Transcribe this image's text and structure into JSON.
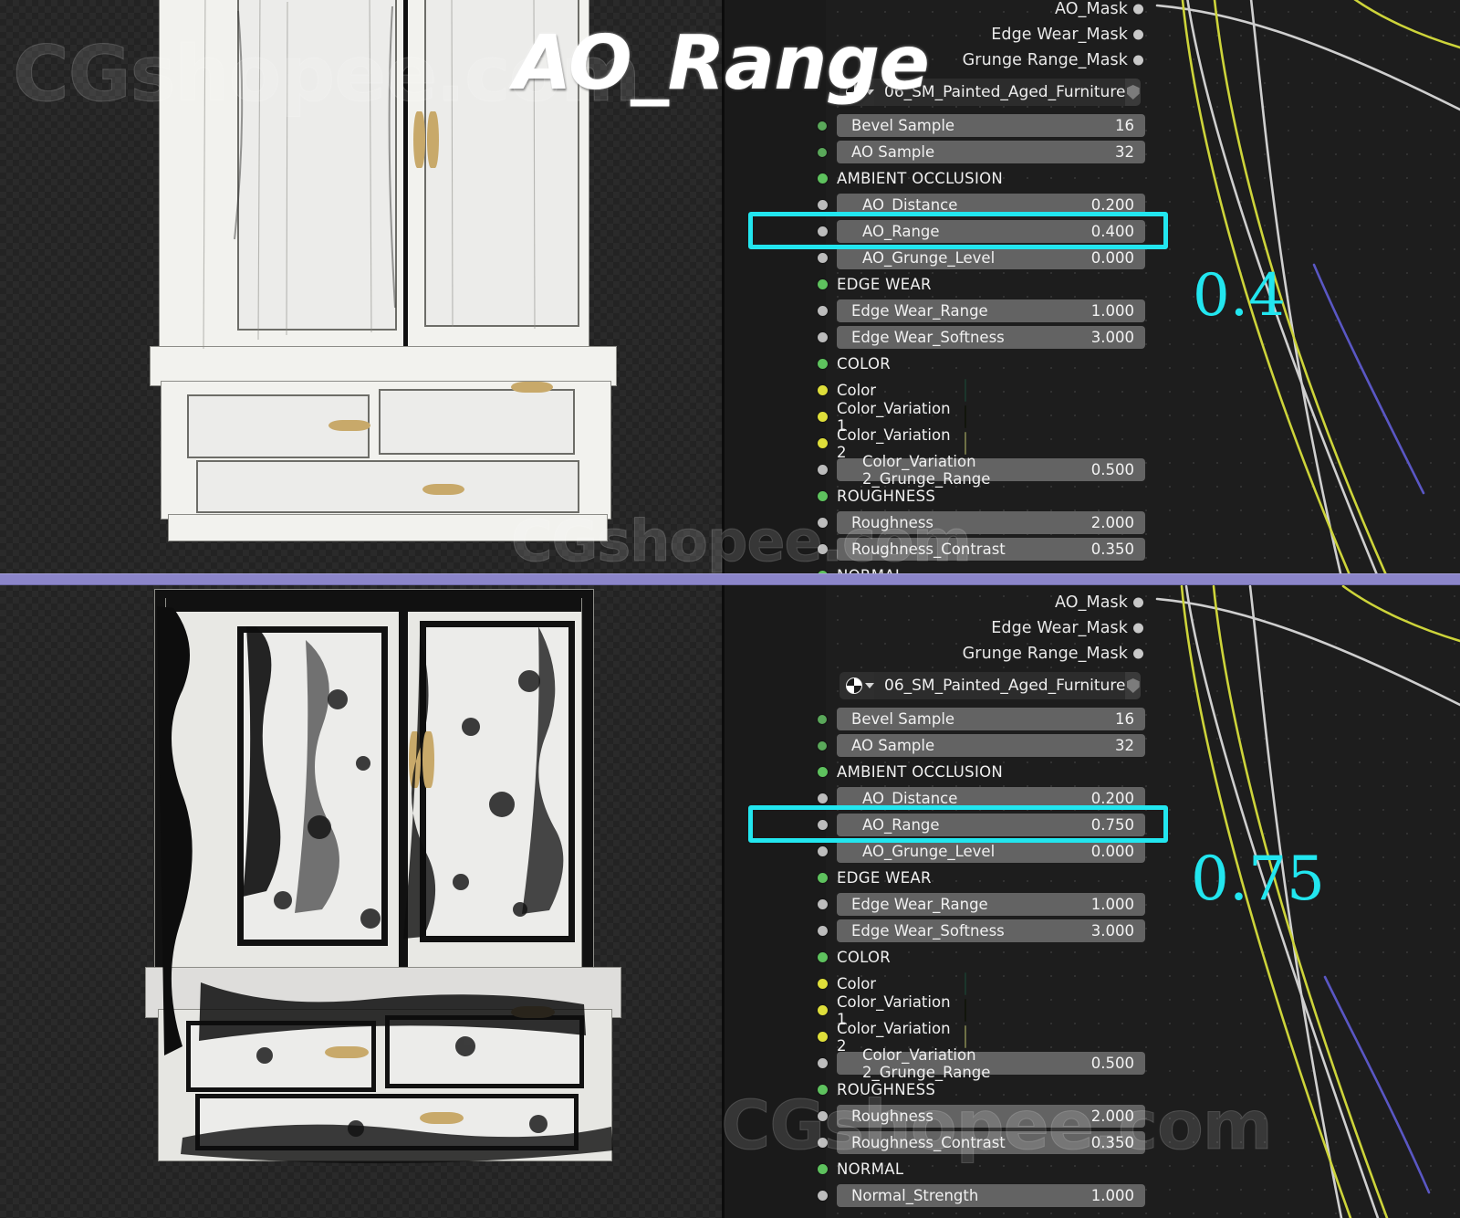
{
  "meta": {
    "title": "AO_Range",
    "watermark": "CGshopee.com",
    "accent_cyan": "#22e6ef",
    "divider_color": "#8b85c9"
  },
  "comparison": [
    {
      "id": "top",
      "annotation_value": "0.4",
      "highlighted_property": "AO_Range",
      "node": {
        "output_sockets": [
          {
            "label": "AO_Mask",
            "color": "#c8c8c8"
          },
          {
            "label": "Edge Wear_Mask",
            "color": "#c8c8c8"
          },
          {
            "label": "Grunge Range_Mask",
            "color": "#c8c8c8"
          }
        ],
        "identifier": {
          "icon": "material-sphere-icon",
          "name": "06_SM_Painted_Aged_Furniture",
          "shield": "fake-user-shield-icon"
        },
        "rows": [
          {
            "kind": "field",
            "socket": "green-s",
            "label": "Bevel Sample",
            "value": "16"
          },
          {
            "kind": "field",
            "socket": "green-s",
            "label": "AO Sample",
            "value": "32"
          },
          {
            "kind": "header",
            "socket": "green",
            "label": "AMBIENT OCCLUSION"
          },
          {
            "kind": "field",
            "socket": "gray",
            "label": "AO_Distance",
            "value": "0.200",
            "indent": true
          },
          {
            "kind": "field",
            "socket": "gray",
            "label": "AO_Range",
            "value": "0.400",
            "indent": true,
            "highlight": true
          },
          {
            "kind": "field",
            "socket": "gray",
            "label": "AO_Grunge_Level",
            "value": "0.000",
            "indent": true
          },
          {
            "kind": "header",
            "socket": "green",
            "label": "EDGE WEAR"
          },
          {
            "kind": "field",
            "socket": "gray",
            "label": "Edge Wear_Range",
            "value": "1.000"
          },
          {
            "kind": "field",
            "socket": "gray",
            "label": "Edge Wear_Softness",
            "value": "3.000"
          },
          {
            "kind": "header",
            "socket": "green",
            "label": "COLOR"
          },
          {
            "kind": "color",
            "socket": "yellow",
            "label": "Color",
            "swatch": "#32624f"
          },
          {
            "kind": "color",
            "socket": "yellow",
            "label": "Color_Variation 1",
            "swatch": "#1f2714"
          },
          {
            "kind": "color",
            "socket": "yellow",
            "label": "Color_Variation 2",
            "swatch": "#c6cd7e"
          },
          {
            "kind": "field",
            "socket": "gray",
            "label": "Color_Variation 2_Grunge_Range",
            "value": "0.500",
            "indent": true
          },
          {
            "kind": "header",
            "socket": "green",
            "label": "ROUGHNESS"
          },
          {
            "kind": "field",
            "socket": "gray",
            "label": "Roughness",
            "value": "2.000"
          },
          {
            "kind": "field",
            "socket": "gray",
            "label": "Roughness_Contrast",
            "value": "0.350"
          },
          {
            "kind": "header",
            "socket": "green",
            "label": "NORMAL"
          }
        ]
      }
    },
    {
      "id": "bottom",
      "annotation_value": "0.75",
      "highlighted_property": "AO_Range",
      "node": {
        "output_sockets": [
          {
            "label": "AO_Mask",
            "color": "#c8c8c8"
          },
          {
            "label": "Edge Wear_Mask",
            "color": "#c8c8c8"
          },
          {
            "label": "Grunge Range_Mask",
            "color": "#c8c8c8"
          }
        ],
        "identifier": {
          "icon": "material-sphere-icon",
          "name": "06_SM_Painted_Aged_Furniture",
          "shield": "fake-user-shield-icon"
        },
        "rows": [
          {
            "kind": "field",
            "socket": "green-s",
            "label": "Bevel Sample",
            "value": "16"
          },
          {
            "kind": "field",
            "socket": "green-s",
            "label": "AO Sample",
            "value": "32"
          },
          {
            "kind": "header",
            "socket": "green",
            "label": "AMBIENT OCCLUSION"
          },
          {
            "kind": "field",
            "socket": "gray",
            "label": "AO_Distance",
            "value": "0.200",
            "indent": true
          },
          {
            "kind": "field",
            "socket": "gray",
            "label": "AO_Range",
            "value": "0.750",
            "indent": true,
            "highlight": true
          },
          {
            "kind": "field",
            "socket": "gray",
            "label": "AO_Grunge_Level",
            "value": "0.000",
            "indent": true
          },
          {
            "kind": "header",
            "socket": "green",
            "label": "EDGE WEAR"
          },
          {
            "kind": "field",
            "socket": "gray",
            "label": "Edge Wear_Range",
            "value": "1.000"
          },
          {
            "kind": "field",
            "socket": "gray",
            "label": "Edge Wear_Softness",
            "value": "3.000"
          },
          {
            "kind": "header",
            "socket": "green",
            "label": "COLOR"
          },
          {
            "kind": "color",
            "socket": "yellow",
            "label": "Color",
            "swatch": "#32624f"
          },
          {
            "kind": "color",
            "socket": "yellow",
            "label": "Color_Variation 1",
            "swatch": "#1f2714"
          },
          {
            "kind": "color",
            "socket": "yellow",
            "label": "Color_Variation 2",
            "swatch": "#c6cd7e"
          },
          {
            "kind": "field",
            "socket": "gray",
            "label": "Color_Variation 2_Grunge_Range",
            "value": "0.500",
            "indent": true
          },
          {
            "kind": "header",
            "socket": "green",
            "label": "ROUGHNESS"
          },
          {
            "kind": "field",
            "socket": "gray",
            "label": "Roughness",
            "value": "2.000"
          },
          {
            "kind": "field",
            "socket": "gray",
            "label": "Roughness_Contrast",
            "value": "0.350"
          },
          {
            "kind": "header",
            "socket": "green",
            "label": "NORMAL"
          },
          {
            "kind": "field",
            "socket": "gray",
            "label": "Normal_Strength",
            "value": "1.000"
          }
        ]
      }
    }
  ],
  "noodle_colors": {
    "value": "#cfcfcf",
    "shader": "#cdd43a",
    "vector": "#5a57c4"
  }
}
